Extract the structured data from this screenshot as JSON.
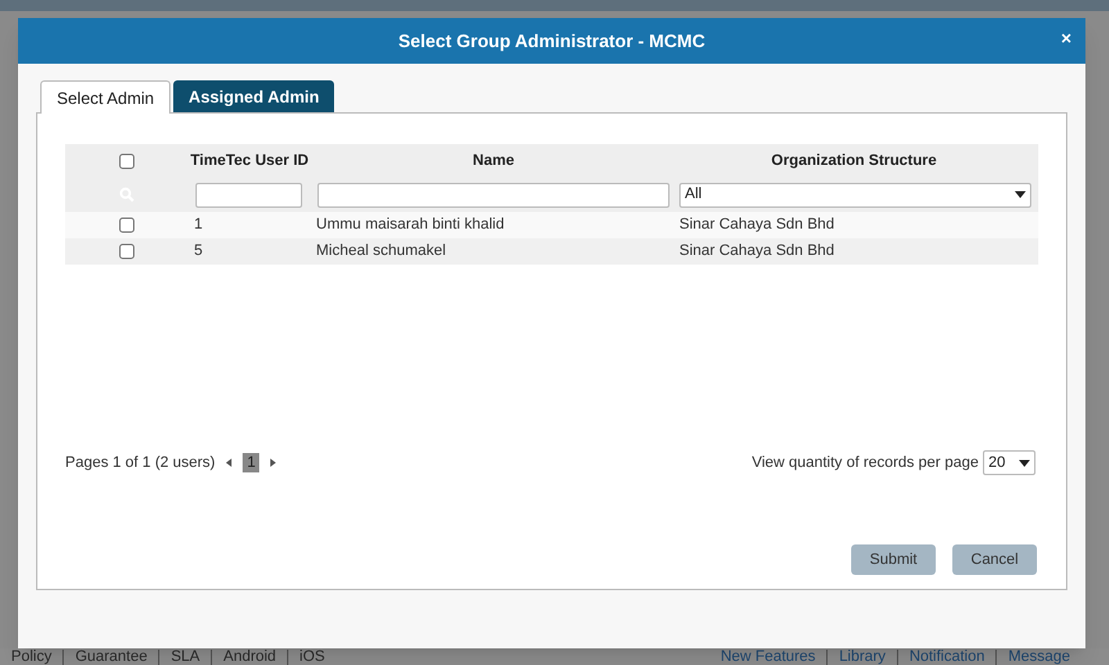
{
  "dialog": {
    "title": "Select Group Administrator - MCMC",
    "close": "×"
  },
  "tabs": [
    {
      "label": "Select Admin",
      "selected": true
    },
    {
      "label": "Assigned Admin",
      "selected": false
    }
  ],
  "table": {
    "columns": [
      "TimeTec User ID",
      "Name",
      "Organization Structure"
    ],
    "header_checked": false,
    "filters": {
      "org_value": "All"
    },
    "rows": [
      {
        "checked": false,
        "id": "1",
        "name": "Ummu maisarah binti khalid",
        "org": "Sinar Cahaya Sdn Bhd"
      },
      {
        "checked": false,
        "id": "5",
        "name": "Micheal schumakel",
        "org": "Sinar Cahaya Sdn Bhd"
      }
    ]
  },
  "pagination": {
    "summary": "Pages 1 of 1 (2 users)",
    "pages": [
      {
        "label": "1",
        "selected": true
      }
    ],
    "per_page_label": "View quantity of records per page",
    "per_page": "20"
  },
  "buttons": [
    "Submit",
    "Cancel"
  ],
  "footer": {
    "left_links": [
      "Policy",
      "Guarantee",
      "SLA",
      "Android",
      "iOS"
    ],
    "right_links": [
      "New Features",
      "Library",
      "Notification",
      "Message"
    ]
  }
}
